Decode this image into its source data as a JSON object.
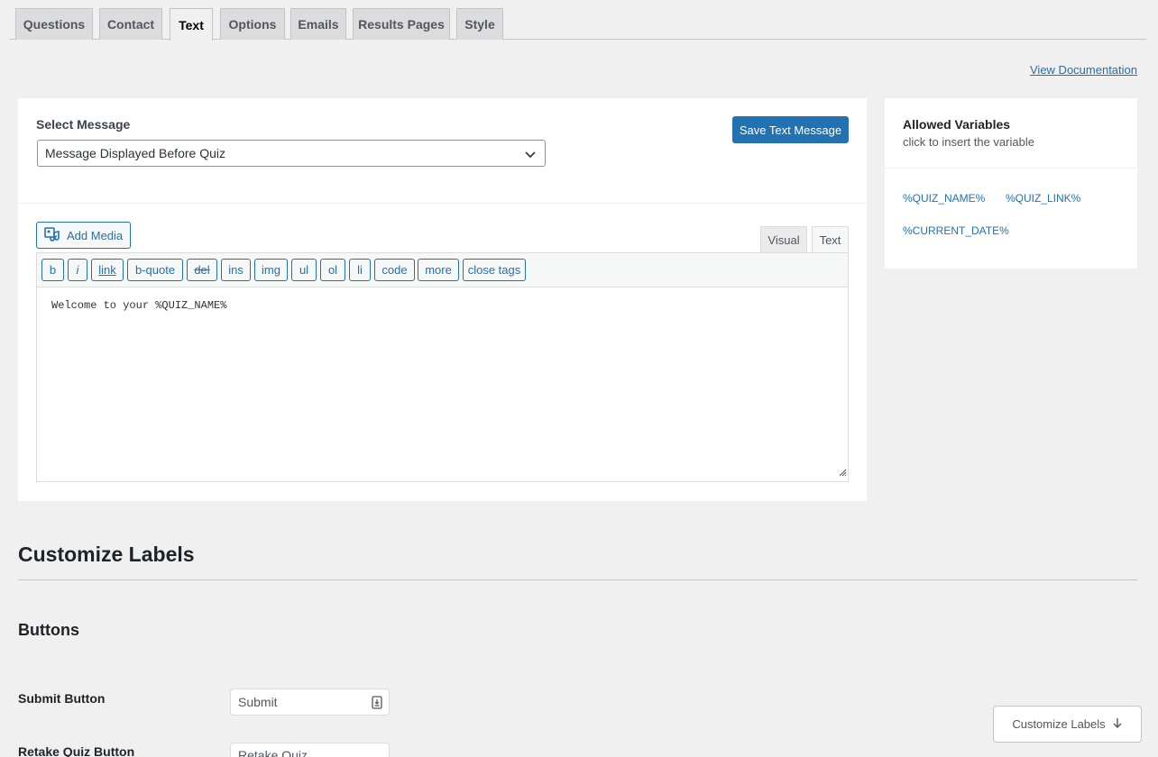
{
  "tabs": [
    {
      "label": "Questions",
      "active": false
    },
    {
      "label": "Contact",
      "active": false
    },
    {
      "label": "Text",
      "active": true
    },
    {
      "label": "Options",
      "active": false
    },
    {
      "label": "Emails",
      "active": false
    },
    {
      "label": "Results Pages",
      "active": false
    },
    {
      "label": "Style",
      "active": false
    }
  ],
  "view_documentation": "View Documentation",
  "message": {
    "select_label": "Select Message",
    "selected": "Message Displayed Before Quiz",
    "save_label": "Save Text Message"
  },
  "editor": {
    "add_media": "Add Media",
    "mode_visual": "Visual",
    "mode_text": "Text",
    "quicktags": [
      "b",
      "i",
      "link",
      "b-quote",
      "del",
      "ins",
      "img",
      "ul",
      "ol",
      "li",
      "code",
      "more",
      "close tags"
    ],
    "content": "Welcome to your %QUIZ_NAME%"
  },
  "variables": {
    "title": "Allowed Variables",
    "subtitle": "click to insert the variable",
    "items": [
      "%QUIZ_NAME%",
      "%QUIZ_LINK%",
      "%CURRENT_DATE%"
    ]
  },
  "customize": {
    "title": "Customize Labels",
    "buttons_heading": "Buttons",
    "fields": [
      {
        "label": "Submit Button",
        "value": "Submit"
      },
      {
        "label": "Retake Quiz Button",
        "value": "Retake Quiz"
      }
    ],
    "float_button": "Customize Labels"
  },
  "colors": {
    "accent": "#2271b1",
    "background": "#f0f0f1"
  }
}
